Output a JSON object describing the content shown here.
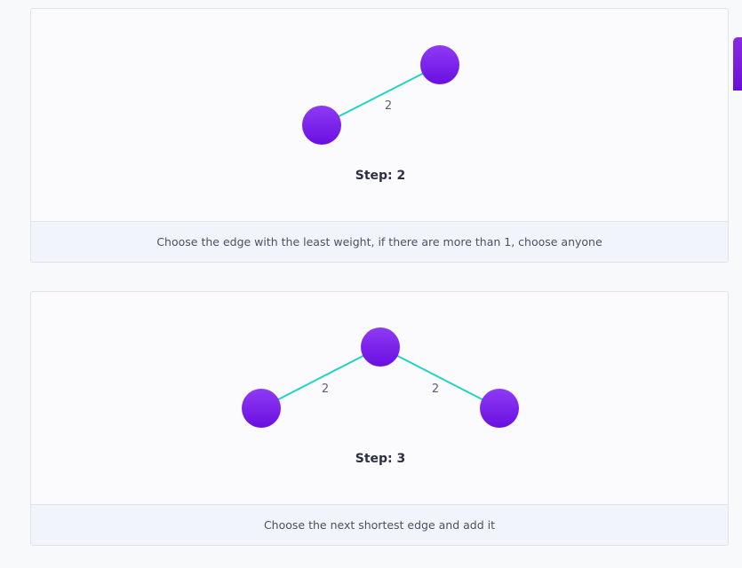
{
  "steps": [
    {
      "label": "Step: 2",
      "caption": "Choose the edge with the least weight, if there are more than 1, choose anyone",
      "edges": [
        {
          "weight": "2"
        }
      ]
    },
    {
      "label": "Step: 3",
      "caption": "Choose the next shortest edge and add it",
      "edges": [
        {
          "weight": "2"
        },
        {
          "weight": "2"
        }
      ]
    }
  ],
  "colors": {
    "node": "#7b1ff0",
    "edge": "#22d3c5",
    "accent_tab": "#7a1fe6"
  }
}
